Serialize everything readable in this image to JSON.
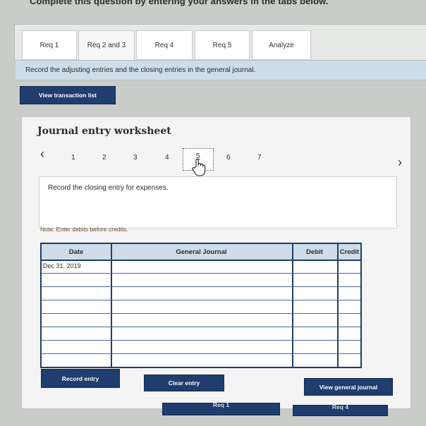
{
  "header": {
    "text": "Complete this question by entering your answers in the tabs below."
  },
  "tabs": [
    {
      "label": "Req 1"
    },
    {
      "label": "Req 2 and 3"
    },
    {
      "label": "Req 4"
    },
    {
      "label": "Req 5"
    },
    {
      "label": "Analyze"
    }
  ],
  "instruction": "Record the adjusting entries and the closing entries in the general journal.",
  "view_transaction_list": "View transaction list",
  "worksheet": {
    "title": "Journal entry worksheet",
    "prev_arrow": "‹",
    "next_arrow": "›",
    "pages": [
      "1",
      "2",
      "3",
      "4",
      "5",
      "6",
      "7"
    ],
    "current_page": 5,
    "entry_description": "Record the closing entry for expenses.",
    "note": "Note: Enter debits before credits.",
    "table": {
      "headers": {
        "date": "Date",
        "general_journal": "General Journal",
        "debit": "Debit",
        "credit": "Credit"
      },
      "rows": [
        {
          "date": "Dec 31, 2019"
        },
        {
          "date": ""
        },
        {
          "date": ""
        },
        {
          "date": ""
        },
        {
          "date": ""
        },
        {
          "date": ""
        },
        {
          "date": ""
        },
        {
          "date": ""
        }
      ]
    },
    "buttons": {
      "record": "Record entry",
      "clear": "Clear entry",
      "view_journal": "View general journal"
    }
  },
  "bottom_nav": {
    "prev_label": "Req 1",
    "next_label": "Req 4"
  },
  "colors": {
    "button_dark": "#1f3d6e",
    "instruction_bar": "#cfdde9"
  }
}
